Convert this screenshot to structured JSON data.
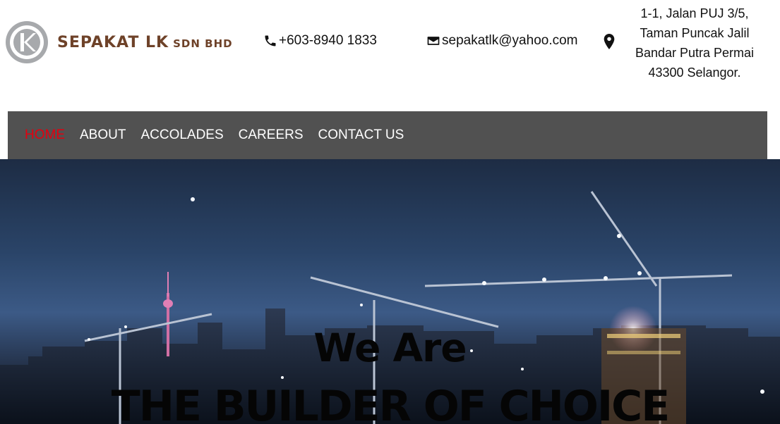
{
  "brand": {
    "name": "SEPAKAT LK",
    "suffix": "SDN BHD",
    "logo_color": "#6e4229"
  },
  "contact": {
    "phone": "+603-8940 1833",
    "email": "sepakatlk@yahoo.com",
    "address_lines": [
      "1-1, Jalan PUJ 3/5,",
      "Taman Puncak Jalil",
      "Bandar Putra Permai",
      "43300 Selangor."
    ]
  },
  "nav": {
    "items": [
      {
        "label": "HOME",
        "active": true
      },
      {
        "label": "ABOUT",
        "active": false
      },
      {
        "label": "ACCOLADES",
        "active": false
      },
      {
        "label": "CAREERS",
        "active": false
      },
      {
        "label": "CONTACT US",
        "active": false
      }
    ],
    "active_color": "#e3000f",
    "background": "#515151"
  },
  "hero": {
    "line1": "We Are",
    "line2": "THE BUILDER OF CHOICE"
  },
  "icons": {
    "logo": "sepakat-logo-mark",
    "phone": "phone-icon",
    "email": "envelope-icon",
    "location": "map-pin-icon"
  }
}
